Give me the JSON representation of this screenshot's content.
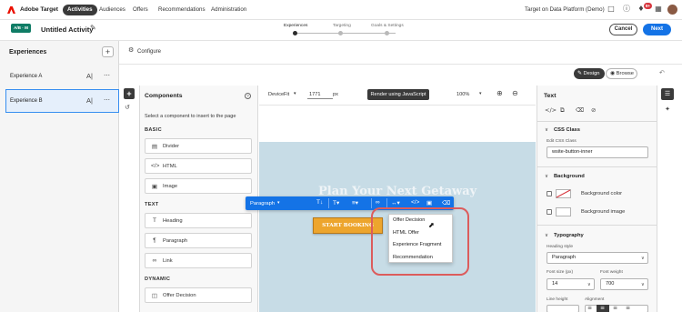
{
  "topbar": {
    "app_title": "Adobe Target",
    "nav": [
      "Activities",
      "Audiences",
      "Offers",
      "Recommendations",
      "Administration"
    ],
    "active_nav": "Activities",
    "workspace": "Target on Data Platform (Demo)",
    "notification_count": "9+"
  },
  "header": {
    "badge": "A/B · M",
    "title": "Untitled Activity",
    "steps": [
      "Experiences",
      "Targeting",
      "Goals & Settings"
    ],
    "cancel_label": "Cancel",
    "next_label": "Next"
  },
  "experiences": {
    "heading": "Experiences",
    "items": [
      {
        "label": "Experience A",
        "selected": false
      },
      {
        "label": "Experience B",
        "selected": true
      }
    ]
  },
  "configure": {
    "label": "Configure"
  },
  "view_toggle": {
    "design": "Design",
    "browse": "Browse"
  },
  "components": {
    "title": "Components",
    "subtitle": "Select a component to insert to the page",
    "sections": [
      {
        "name": "BASIC",
        "items": [
          {
            "label": "Divider",
            "icon": "divider-icon"
          },
          {
            "label": "HTML",
            "icon": "code-icon"
          },
          {
            "label": "Image",
            "icon": "image-icon"
          }
        ]
      },
      {
        "name": "TEXT",
        "items": [
          {
            "label": "Heading",
            "icon": "heading-icon"
          },
          {
            "label": "Paragraph",
            "icon": "paragraph-icon"
          },
          {
            "label": "Link",
            "icon": "link-icon"
          }
        ]
      },
      {
        "name": "DYNAMIC",
        "items": [
          {
            "label": "Offer Decision",
            "icon": "offer-decision-icon"
          }
        ]
      }
    ]
  },
  "canvas_toolbar": {
    "device_label": "Device",
    "device_value": "Fit",
    "width_value": "1771",
    "width_unit": "px",
    "render_button": "Render using JavaScript",
    "zoom": "100%"
  },
  "canvas": {
    "hero_title": "Plan Your Next Getaway",
    "cta_label": "START BOOKING",
    "element_toolbar_label": "Paragraph",
    "insert_menu": [
      "Offer Decision",
      "HTML Offer",
      "Experience Fragment",
      "Recommendation"
    ]
  },
  "props": {
    "title": "Text",
    "css_section": "CSS Class",
    "edit_css_label": "Edit CSS Class",
    "css_value": "wsite-button-inner",
    "background_section": "Background",
    "bg_color_label": "Background color",
    "bg_image_label": "Background image",
    "typography_section": "Typography",
    "heading_style_label": "Heading style",
    "heading_style_value": "Paragraph",
    "font_size_label": "Font size (px)",
    "font_size_value": "14",
    "font_weight_label": "Font weight",
    "font_weight_value": "700",
    "line_height_label": "Line height",
    "alignment_label": "Alignment"
  }
}
